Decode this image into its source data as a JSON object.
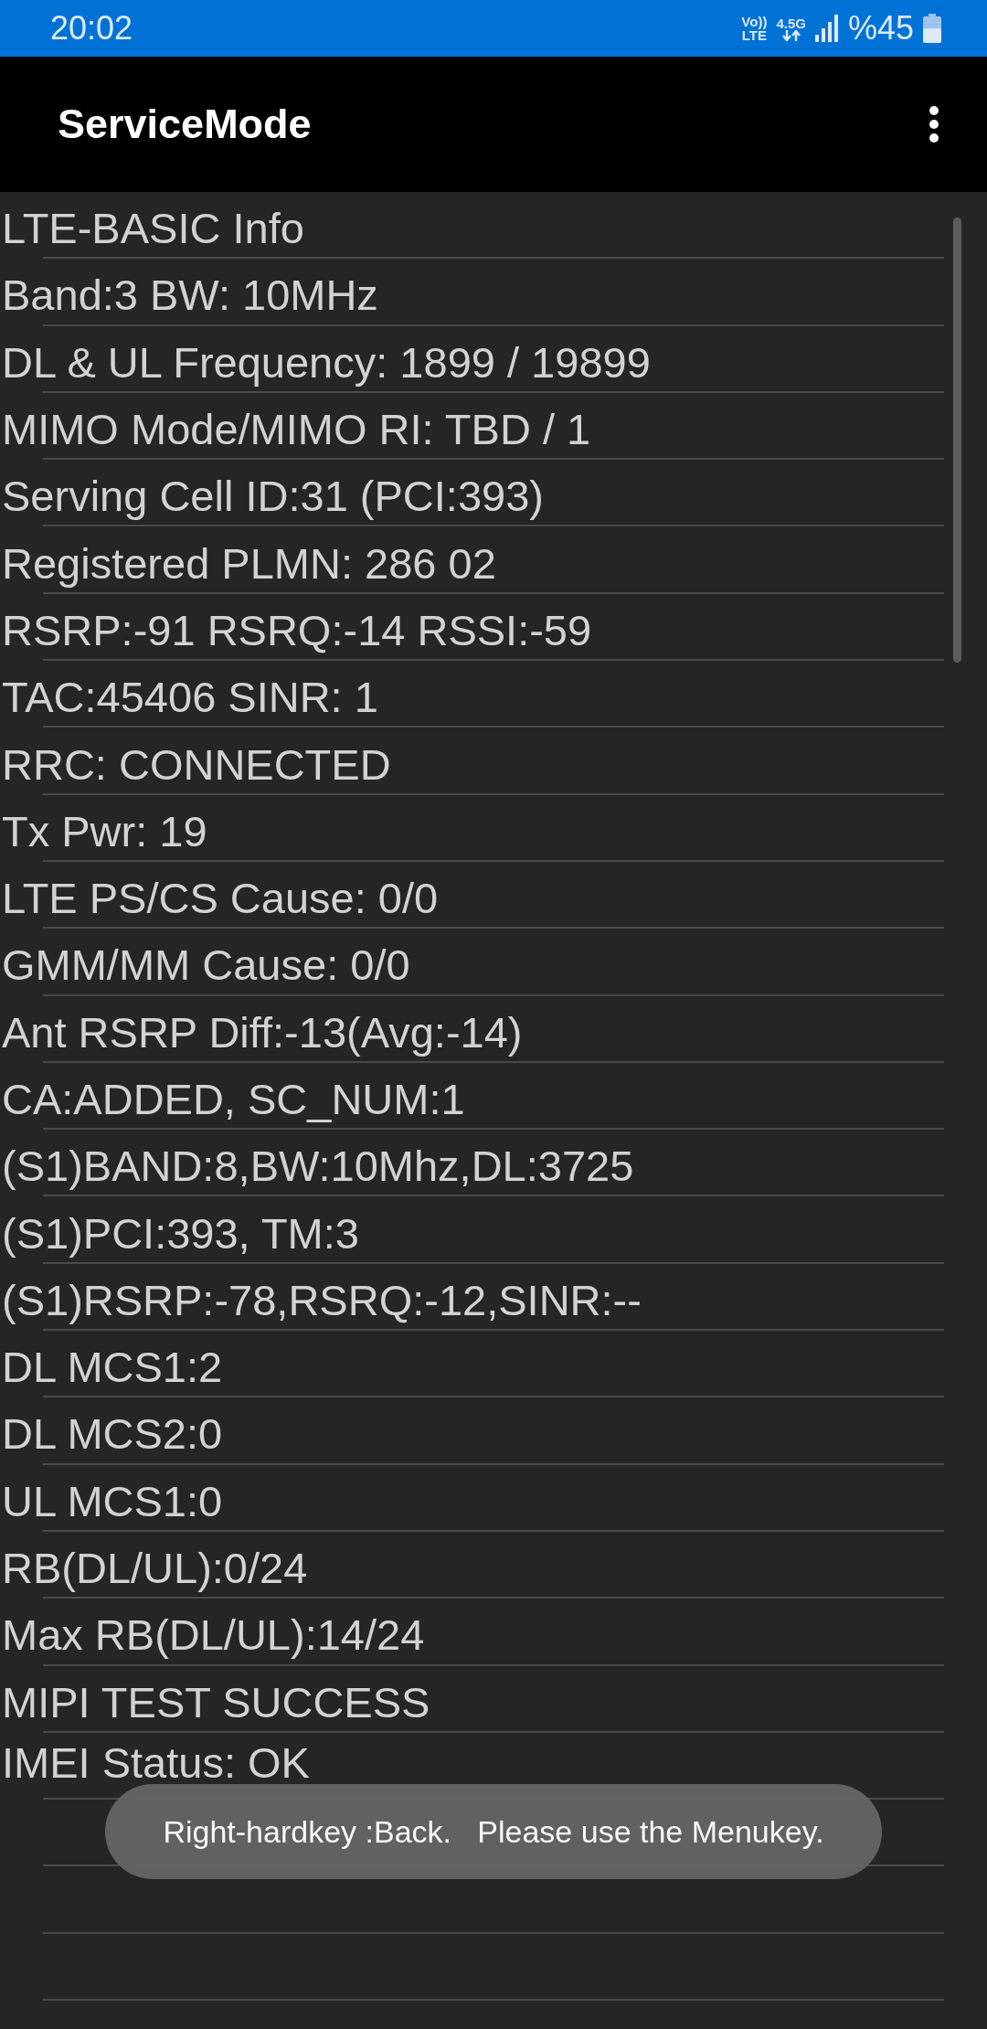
{
  "status_bar": {
    "time": "20:02",
    "volte_top": "Vo))",
    "volte_bottom": "LTE",
    "network": "4.5G",
    "battery": "%45"
  },
  "app_bar": {
    "title": "ServiceMode"
  },
  "lines": [
    "LTE-BASIC Info",
    "Band:3 BW: 10MHz",
    "DL & UL Frequency: 1899 / 19899",
    "MIMO Mode/MIMO RI: TBD / 1",
    "Serving Cell ID:31 (PCI:393)",
    "Registered PLMN: 286 02",
    "RSRP:-91 RSRQ:-14 RSSI:-59",
    "TAC:45406 SINR: 1",
    "RRC: CONNECTED",
    "Tx Pwr: 19",
    "LTE PS/CS Cause: 0/0",
    "GMM/MM Cause: 0/0",
    "Ant RSRP Diff:-13(Avg:-14)",
    "CA:ADDED, SC_NUM:1",
    "(S1)BAND:8,BW:10Mhz,DL:3725",
    "(S1)PCI:393, TM:3",
    "(S1)RSRP:-78,RSRQ:-12,SINR:--",
    "DL MCS1:2",
    "DL MCS2:0",
    "UL MCS1:0",
    "RB(DL/UL):0/24",
    "Max RB(DL/UL):14/24",
    "MIPI TEST SUCCESS",
    "IMEI Status: OK"
  ],
  "toast": "Right-hardkey :Back.   Please use the Menukey."
}
